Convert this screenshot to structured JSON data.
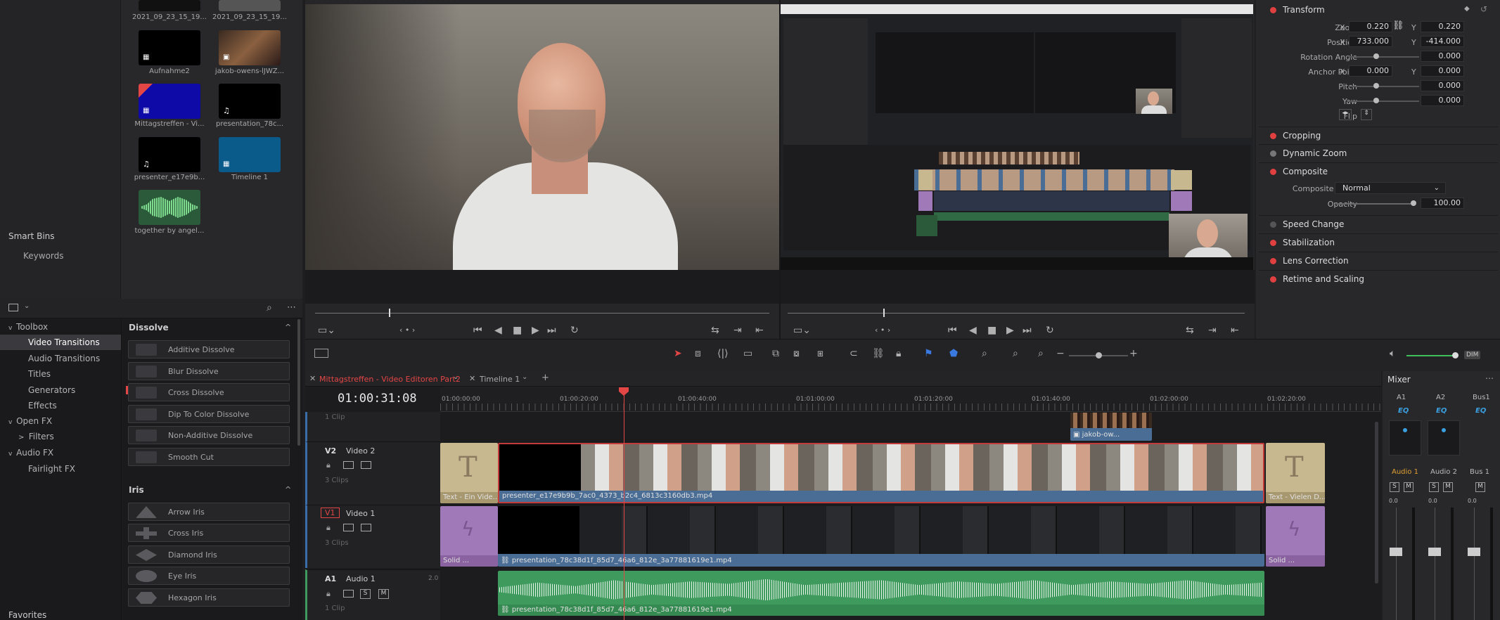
{
  "media_pool": {
    "items": [
      {
        "caption": "2021_09_23_15_19..."
      },
      {
        "caption": "2021_09_23_15_19..."
      },
      {
        "caption": "Aufnahme2"
      },
      {
        "caption": "jakob-owens-lJWZ..."
      },
      {
        "caption": "Mittagstreffen - Vi..."
      },
      {
        "caption": "presentation_78c..."
      },
      {
        "caption": "presenter_e17e9b..."
      },
      {
        "caption": "Timeline 1"
      },
      {
        "caption": "together by angel..."
      }
    ],
    "smart_bins": "Smart Bins",
    "keywords": "Keywords",
    "favorites": "Favorites"
  },
  "effects": {
    "toolbox": "Toolbox",
    "video_transitions": "Video Transitions",
    "audio_transitions": "Audio Transitions",
    "titles": "Titles",
    "generators": "Generators",
    "effects": "Effects",
    "open_fx": "Open FX",
    "filters": "Filters",
    "audio_fx": "Audio FX",
    "fairlight_fx": "Fairlight FX",
    "dissolve_header": "Dissolve",
    "dissolve": [
      "Additive Dissolve",
      "Blur Dissolve",
      "Cross Dissolve",
      "Dip To Color Dissolve",
      "Non-Additive Dissolve",
      "Smooth Cut"
    ],
    "iris_header": "Iris",
    "iris": [
      "Arrow Iris",
      "Cross Iris",
      "Diamond Iris",
      "Eye Iris",
      "Hexagon Iris"
    ]
  },
  "inspector": {
    "transform": "Transform",
    "zoom_label": "Zoom",
    "zoom_x": "0.220",
    "zoom_y": "0.220",
    "position_label": "Position",
    "pos_x": "733.000",
    "pos_y": "-414.000",
    "rotation_label": "Rotation Angle",
    "rotation": "0.000",
    "anchor_label": "Anchor Point",
    "anchor_x": "0.000",
    "anchor_y": "0.000",
    "pitch_label": "Pitch",
    "pitch": "0.000",
    "yaw_label": "Yaw",
    "yaw": "0.000",
    "flip_label": "Flip",
    "x": "X",
    "y": "Y",
    "cropping": "Cropping",
    "dynamic_zoom": "Dynamic Zoom",
    "composite": "Composite",
    "composite_mode_label": "Composite Mode",
    "composite_mode": "Normal",
    "opacity_label": "Opacity",
    "opacity": "100.00",
    "speed_change": "Speed Change",
    "stabilization": "Stabilization",
    "lens_correction": "Lens Correction",
    "retime": "Retime and Scaling"
  },
  "timeline": {
    "tab_active": "Mittagstreffen - Video Editoren Part2",
    "tab_other": "Timeline 1",
    "timecode": "01:00:31:08",
    "ruler": [
      "01:00:00:00",
      "01:00:20:00",
      "01:00:40:00",
      "01:01:00:00",
      "01:01:20:00",
      "01:01:40:00",
      "01:02:00:00",
      "01:02:20:00"
    ],
    "v3_clips": "1 Clip",
    "v2_id": "V2",
    "v2_name": "Video 2",
    "v2_clips": "3 Clips",
    "v1_id": "V1",
    "v1_name": "Video 1",
    "v1_clips": "3 Clips",
    "a1_id": "A1",
    "a1_name": "Audio 1",
    "a1_ch": "2.0",
    "a1_clips": "1 Clip",
    "clip_jakob": "jakob-ow...",
    "clip_text_left": "Text - Ein Vide...",
    "clip_presenter": "presenter_e17e9b9b_7ac0_4373_b2c4_6813c3160db3.mp4",
    "clip_text_right": "Text - Vielen D...",
    "clip_solid_left": "Solid ...",
    "clip_presentation": "presentation_78c38d1f_85d7_46a6_812e_3a77881619e1.mp4",
    "clip_solid_right": "Solid ...",
    "clip_audio": "presentation_78c38d1f_85d7_46a6_812e_3a77881619e1.mp4",
    "s": "S",
    "m": "M"
  },
  "mixer": {
    "title": "Mixer",
    "ch": [
      "A1",
      "A2",
      "Bus1"
    ],
    "eq": "EQ",
    "strip": [
      "Audio 1",
      "Audio 2",
      "Bus 1"
    ],
    "zero": "0.0",
    "dim": "DIM"
  },
  "colors": {
    "accent": "#e44545",
    "video_clip": "#4a6d95",
    "audio_clip": "#3f9a5e",
    "title_clip": "#c8b890",
    "solid_clip": "#a07ab8"
  }
}
